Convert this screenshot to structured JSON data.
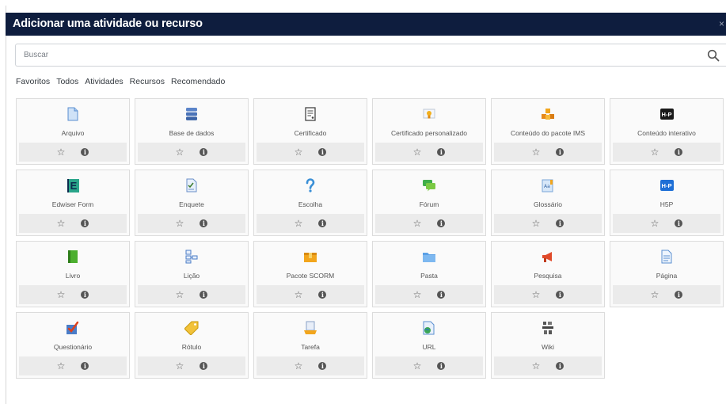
{
  "modal": {
    "title": "Adicionar uma atividade ou recurso",
    "close": "×"
  },
  "search": {
    "placeholder": "Buscar"
  },
  "tabs": [
    "Favoritos",
    "Todos",
    "Atividades",
    "Recursos",
    "Recomendado"
  ],
  "items": [
    {
      "label": "Arquivo",
      "icon": "file-icon"
    },
    {
      "label": "Base de dados",
      "icon": "database-icon"
    },
    {
      "label": "Certificado",
      "icon": "certificate-icon"
    },
    {
      "label": "Certificado personalizado",
      "icon": "custom-certificate-icon"
    },
    {
      "label": "Conteúdo do pacote IMS",
      "icon": "ims-package-icon"
    },
    {
      "label": "Conteúdo interativo",
      "icon": "h5p-interactive-icon",
      "badge": "H-P"
    },
    {
      "label": "Edwiser Form",
      "icon": "edwiser-form-icon",
      "badge": "E"
    },
    {
      "label": "Enquete",
      "icon": "survey-icon"
    },
    {
      "label": "Escolha",
      "icon": "choice-icon"
    },
    {
      "label": "Fórum",
      "icon": "forum-icon"
    },
    {
      "label": "Glossário",
      "icon": "glossary-icon"
    },
    {
      "label": "H5P",
      "icon": "h5p-icon",
      "badge": "H-P"
    },
    {
      "label": "Livro",
      "icon": "book-icon"
    },
    {
      "label": "Lição",
      "icon": "lesson-icon"
    },
    {
      "label": "Pacote SCORM",
      "icon": "scorm-package-icon"
    },
    {
      "label": "Pasta",
      "icon": "folder-icon"
    },
    {
      "label": "Pesquisa",
      "icon": "feedback-megaphone-icon"
    },
    {
      "label": "Página",
      "icon": "page-icon"
    },
    {
      "label": "Questionário",
      "icon": "quiz-icon"
    },
    {
      "label": "Rótulo",
      "icon": "label-tag-icon"
    },
    {
      "label": "Tarefa",
      "icon": "assignment-icon"
    },
    {
      "label": "URL",
      "icon": "url-icon"
    },
    {
      "label": "Wiki",
      "icon": "wiki-icon"
    }
  ]
}
